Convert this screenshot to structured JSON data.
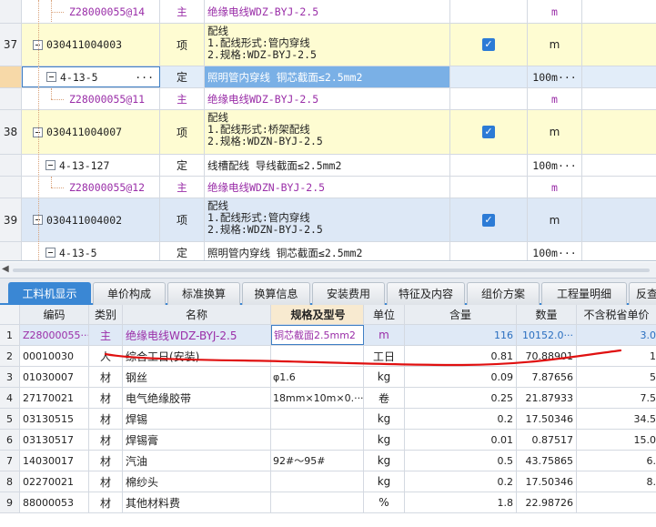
{
  "top_rows": [
    {
      "kind": "child-item",
      "code": "Z28000055@14",
      "type": "主",
      "name": "绝缘电线WDZ-BYJ-2.5",
      "unit": "m"
    },
    {
      "kind": "list",
      "num": "37",
      "code": "030411004003",
      "type": "项",
      "name_lines": [
        "配线",
        "1.配线形式:管内穿线",
        "2.规格:WDZ-BYJ-2.5"
      ],
      "unit": "m",
      "checked": true
    },
    {
      "kind": "quota",
      "code": "4-13-5",
      "more": "···",
      "type": "定",
      "name": "照明管内穿线 铜芯截面≤2.5mm2",
      "unit": "100m···"
    },
    {
      "kind": "child-item",
      "code": "Z28000055@11",
      "type": "主",
      "name": "绝缘电线WDZ-BYJ-2.5",
      "unit": "m"
    },
    {
      "kind": "list",
      "num": "38",
      "code": "030411004007",
      "type": "项",
      "name_lines": [
        "配线",
        "1.配线形式:桥架配线",
        "2.规格:WDZN-BYJ-2.5"
      ],
      "unit": "m",
      "checked": true
    },
    {
      "kind": "quota",
      "code": "4-13-127",
      "type": "定",
      "name": "线槽配线 导线截面≤2.5mm2",
      "unit": "100m···"
    },
    {
      "kind": "child-item",
      "code": "Z28000055@12",
      "type": "主",
      "name": "绝缘电线WDZN-BYJ-2.5",
      "unit": "m"
    },
    {
      "kind": "list",
      "num": "39",
      "code": "030411004002",
      "type": "项",
      "name_lines": [
        "配线",
        "1.配线形式:管内穿线",
        "2.规格:WDZN-BYJ-2.5"
      ],
      "unit": "m",
      "checked": true
    },
    {
      "kind": "quota",
      "code": "4-13-5",
      "type": "定",
      "name": "照明管内穿线 铜芯截面≤2.5mm2",
      "unit": "100m···"
    }
  ],
  "tabs": [
    "工料机显示",
    "单价构成",
    "标准换算",
    "换算信息",
    "安装费用",
    "特征及内容",
    "组价方案",
    "工程量明细",
    "反查"
  ],
  "grid": {
    "headers": [
      "",
      "编码",
      "类别",
      "名称",
      "规格及型号",
      "单位",
      "含量",
      "数量",
      "不含税省单价"
    ],
    "rows": [
      {
        "idx": "1",
        "code": "Z28000055···",
        "type": "主",
        "name": "绝缘电线WDZ-BYJ-2.5",
        "spec": "铜芯截面2.5mm2",
        "unit": "m",
        "qty": "116",
        "num": "10152.0···",
        "price": "3.0"
      },
      {
        "idx": "2",
        "code": "00010030",
        "type": "人",
        "name": "综合工日(安装)",
        "spec": "",
        "unit": "工日",
        "qty": "0.81",
        "num": "70.88901",
        "price": "1"
      },
      {
        "idx": "3",
        "code": "01030007",
        "type": "材",
        "name": "钢丝",
        "spec": "φ1.6",
        "unit": "kg",
        "qty": "0.09",
        "num": "7.87656",
        "price": "5"
      },
      {
        "idx": "4",
        "code": "27170021",
        "type": "材",
        "name": "电气绝缘胶带",
        "spec": "18mm×10m×0.···",
        "unit": "卷",
        "qty": "0.25",
        "num": "21.87933",
        "price": "7.5"
      },
      {
        "idx": "5",
        "code": "03130515",
        "type": "材",
        "name": "焊锡",
        "spec": "",
        "unit": "kg",
        "qty": "0.2",
        "num": "17.50346",
        "price": "34.5"
      },
      {
        "idx": "6",
        "code": "03130517",
        "type": "材",
        "name": "焊锡膏",
        "spec": "",
        "unit": "kg",
        "qty": "0.01",
        "num": "0.87517",
        "price": "15.0"
      },
      {
        "idx": "7",
        "code": "14030017",
        "type": "材",
        "name": "汽油",
        "spec": "92#～95#",
        "unit": "kg",
        "qty": "0.5",
        "num": "43.75865",
        "price": "6."
      },
      {
        "idx": "8",
        "code": "02270021",
        "type": "材",
        "name": "棉纱头",
        "spec": "",
        "unit": "kg",
        "qty": "0.2",
        "num": "17.50346",
        "price": "8."
      },
      {
        "idx": "9",
        "code": "88000053",
        "type": "材",
        "name": "其他材料费",
        "spec": "",
        "unit": "%",
        "qty": "1.8",
        "num": "22.98726",
        "price": ""
      }
    ]
  },
  "colors": {
    "accent": "#3a87d4",
    "item_purple": "#9a2ea8",
    "annotation_red": "#e01010",
    "list_yellow": "#fefcd2",
    "list_blue": "#dde8f6"
  }
}
